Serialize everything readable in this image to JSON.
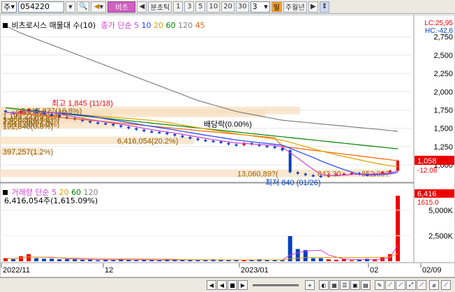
{
  "toolbar": {
    "market_label": "주",
    "code": "054220",
    "chart_type_label": "비츠",
    "period_label": "분초틱",
    "intervals": [
      "1",
      "3",
      "5",
      "10",
      "20",
      "30"
    ],
    "interval_value": "3",
    "day_label": "일",
    "week_month_year_label": "주월년",
    "colors": {
      "active": "#d060c0"
    }
  },
  "price_pane": {
    "stock_label": "비츠로시스 매물대 수(10)",
    "ma_label": "종가 단순",
    "ma_periods": [
      "5",
      "10",
      "20",
      "60",
      "120",
      "45"
    ],
    "ma_colors": [
      "#d040d0",
      "#2040ff",
      "#e0a000",
      "#008000",
      "#808080",
      "#ff6000"
    ],
    "lc_label": "LC:25,95",
    "hc_label": "HC:-42,6",
    "y_ticks": [
      "2,750",
      "2,500",
      "2,250",
      "2,000",
      "1,750",
      "1,500",
      "1,250",
      "1,000"
    ],
    "current_price": "1,058",
    "current_change": "-12.08",
    "high_note": "최고 1,845 (11/18)",
    "low_note": "최저 840 (01/26)",
    "dividend_note": "배당락(0.00%)",
    "volume_profile": [
      "3,317,877(16.8%)",
      "2,9?,?8(15.1%)",
      "1,193,229(6.0%)",
      "1,450,324(4.6%)",
      "226,968(0.7%)",
      "1,915,280(6.0%)",
      "192,848(0.6%)",
      "6,416,054(20.2%)",
      "397,257(1.2%)",
      "13,060,89?(",
      "843.30",
      "852.09?"
    ]
  },
  "volume_pane": {
    "label": "거래량 단순",
    "ma_periods": [
      "5",
      "20",
      "60",
      "120"
    ],
    "ma_colors": [
      "#d040d0",
      "#e0a000",
      "#008000",
      "#808080"
    ],
    "value_label": "6,416,054주(1,615.09%)",
    "current_volume": "6,416",
    "current_pct": "1615.0",
    "y_ticks": [
      "5,000K",
      "2,500K"
    ]
  },
  "x_axis": {
    "labels": [
      "2022/11",
      "12",
      "2023/01",
      "02",
      "02/09"
    ]
  },
  "chart_data": {
    "type": "candlestick",
    "price_closes": [
      1720,
      1700,
      1740,
      1760,
      1710,
      1690,
      1680,
      1650,
      1640,
      1620,
      1600,
      1580,
      1570,
      1560,
      1540,
      1520,
      1500,
      1480,
      1460,
      1450,
      1440,
      1420,
      1400,
      1380,
      1360,
      1340,
      1330,
      1320,
      1300,
      1280,
      1270,
      1300,
      1280,
      1260,
      1250,
      1230,
      1200,
      900,
      880,
      860,
      850,
      840,
      860,
      870,
      880,
      890,
      870,
      860,
      880,
      900,
      920,
      1058
    ],
    "volumes_k": [
      300,
      200,
      500,
      700,
      300,
      250,
      250,
      200,
      200,
      200,
      150,
      200,
      100,
      150,
      120,
      200,
      150,
      100,
      150,
      100,
      100,
      200,
      150,
      150,
      100,
      100,
      150,
      200,
      150,
      100,
      100,
      100,
      150,
      200,
      150,
      100,
      100,
      2500,
      1200,
      1100,
      300,
      300,
      200,
      150,
      200,
      100,
      150,
      250,
      200,
      400,
      700,
      6416
    ],
    "ylim": [
      800,
      2900
    ]
  }
}
